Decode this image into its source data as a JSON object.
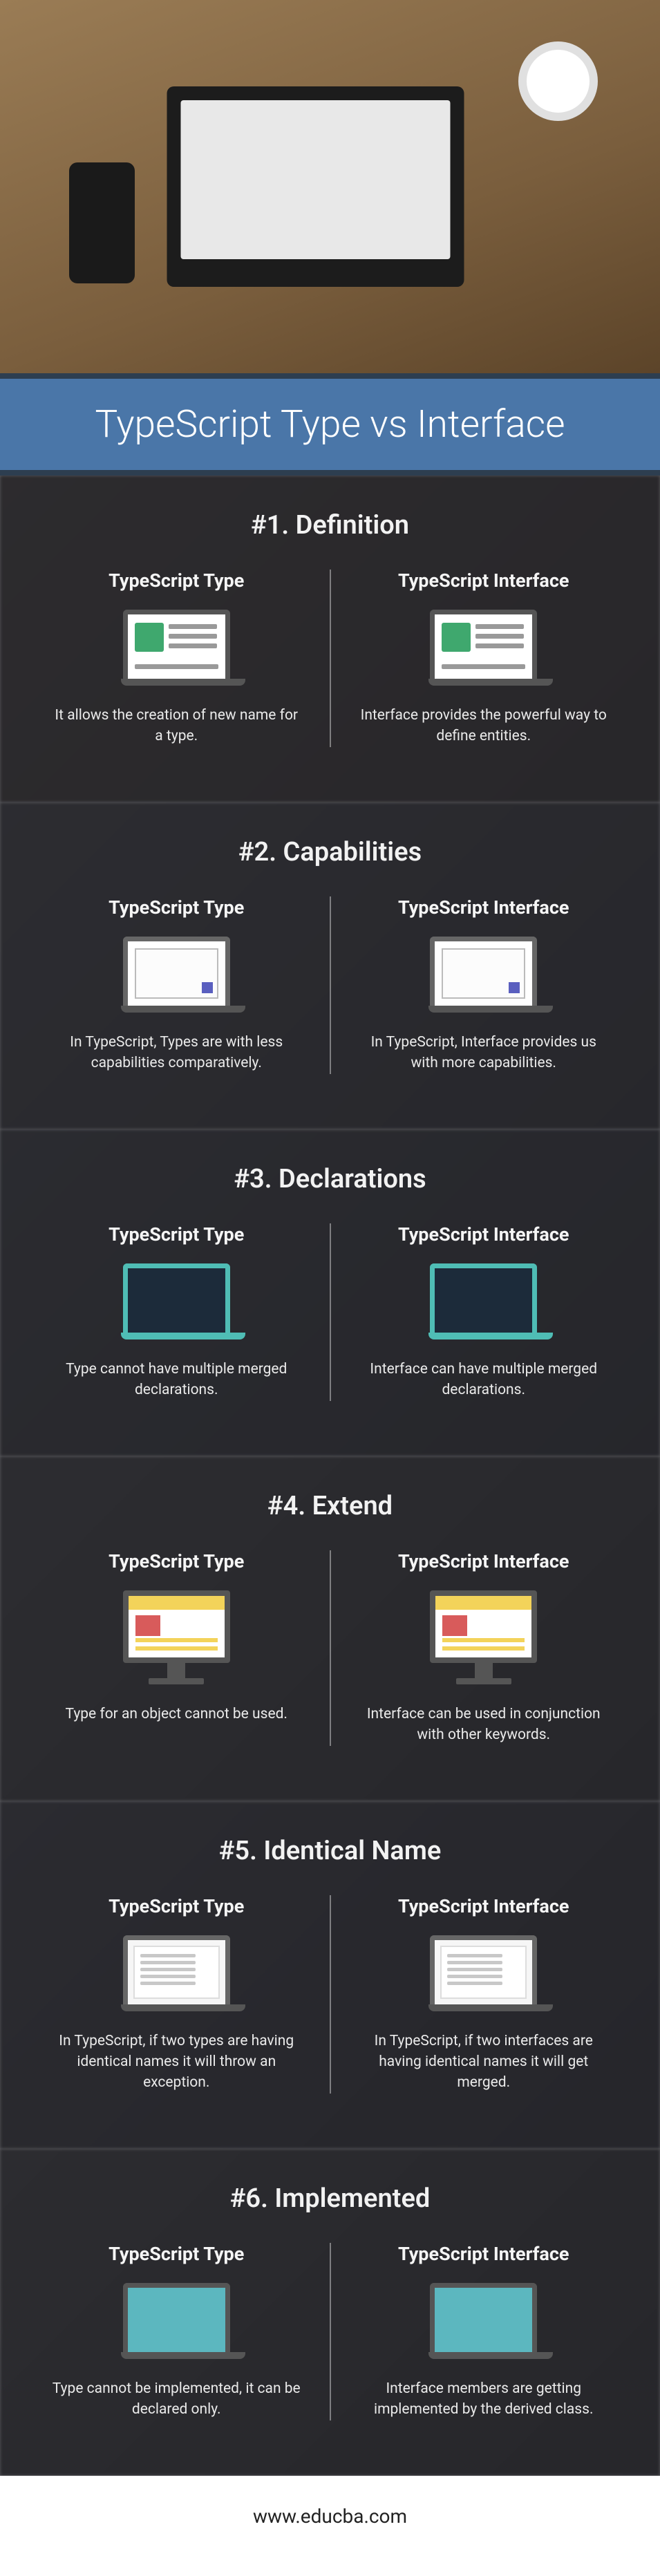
{
  "title": "TypeScript Type vs Interface",
  "left_label": "TypeScript Type",
  "right_label": "TypeScript Interface",
  "sections": [
    {
      "heading": "#1. Definition",
      "left": "It allows the creation of new name for a type.",
      "right": "Interface provides the powerful way to define entities."
    },
    {
      "heading": "#2. Capabilities",
      "left": "In TypeScript, Types are with less capabilities comparatively.",
      "right": "In TypeScript, Interface provides us with more capabilities."
    },
    {
      "heading": "#3. Declarations",
      "left": "Type cannot have multiple merged declarations.",
      "right": "Interface can have multiple merged declarations."
    },
    {
      "heading": "#4. Extend",
      "left": "Type for an object cannot be used.",
      "right": "Interface can be used in conjunction with other keywords."
    },
    {
      "heading": "#5. Identical Name",
      "left": "In TypeScript, if two types are having identical names it will throw an exception.",
      "right": "In TypeScript, if two interfaces are having identical names it will get merged."
    },
    {
      "heading": "#6. Implemented",
      "left": "Type cannot be implemented, it can be declared only.",
      "right": "Interface members are getting implemented by the derived class."
    }
  ],
  "footer": "www.educba.com"
}
